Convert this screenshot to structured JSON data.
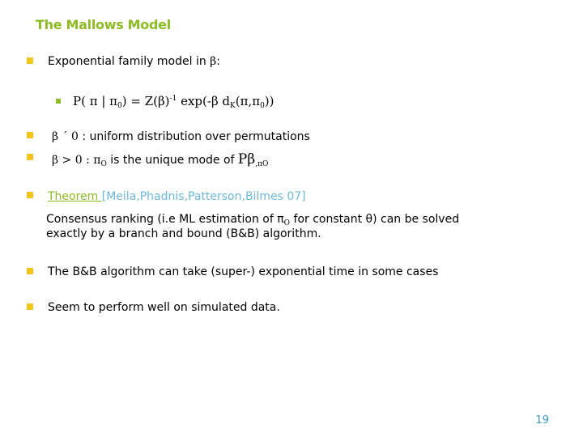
{
  "slide": {
    "title": "The Mallows Model",
    "page_number": "19",
    "colors": {
      "title": "#8dbb22",
      "bullet_primary": "#f5c418",
      "bullet_secondary": "#8dbb22",
      "citation": "#6ab9de",
      "page_number": "#3399cc"
    }
  },
  "bullets": {
    "b1": {
      "text": "Exponential family model in ",
      "symbol": "β",
      "suffix": ":"
    },
    "b1_sub": {
      "p": "P( π | π",
      "p_sub": "0",
      "eq": ") = Z(β)",
      "sup": "-1",
      "exp": " exp(-β d",
      "d_sub": "K",
      "args": "(π,π",
      "args_sub": "0",
      "close": "))"
    },
    "b2": {
      "symbol": "β ´ 0",
      "text": " : uniform distribution over permutations"
    },
    "b3": {
      "cond": "β > 0 :  π",
      "cond_sub": "O",
      "text": " is the unique mode of ",
      "p": "Pβ",
      "p_sub": ",πO"
    },
    "b4": {
      "theorem": "Theorem ",
      "citation": "[Meila,Phadnis,Patterson,Bilmes 07]",
      "para_1a": "Consensus ranking (i.e ML estimation of π",
      "para_1_sub": "O",
      "para_1b": " for constant θ) can be solved",
      "para_2": "exactly by a branch and bound (B&B) algorithm."
    },
    "b5": {
      "text": "The B&B algorithm can take (super-) exponential time in some cases"
    },
    "b6": {
      "text": "Seem to perform well on simulated data."
    }
  }
}
